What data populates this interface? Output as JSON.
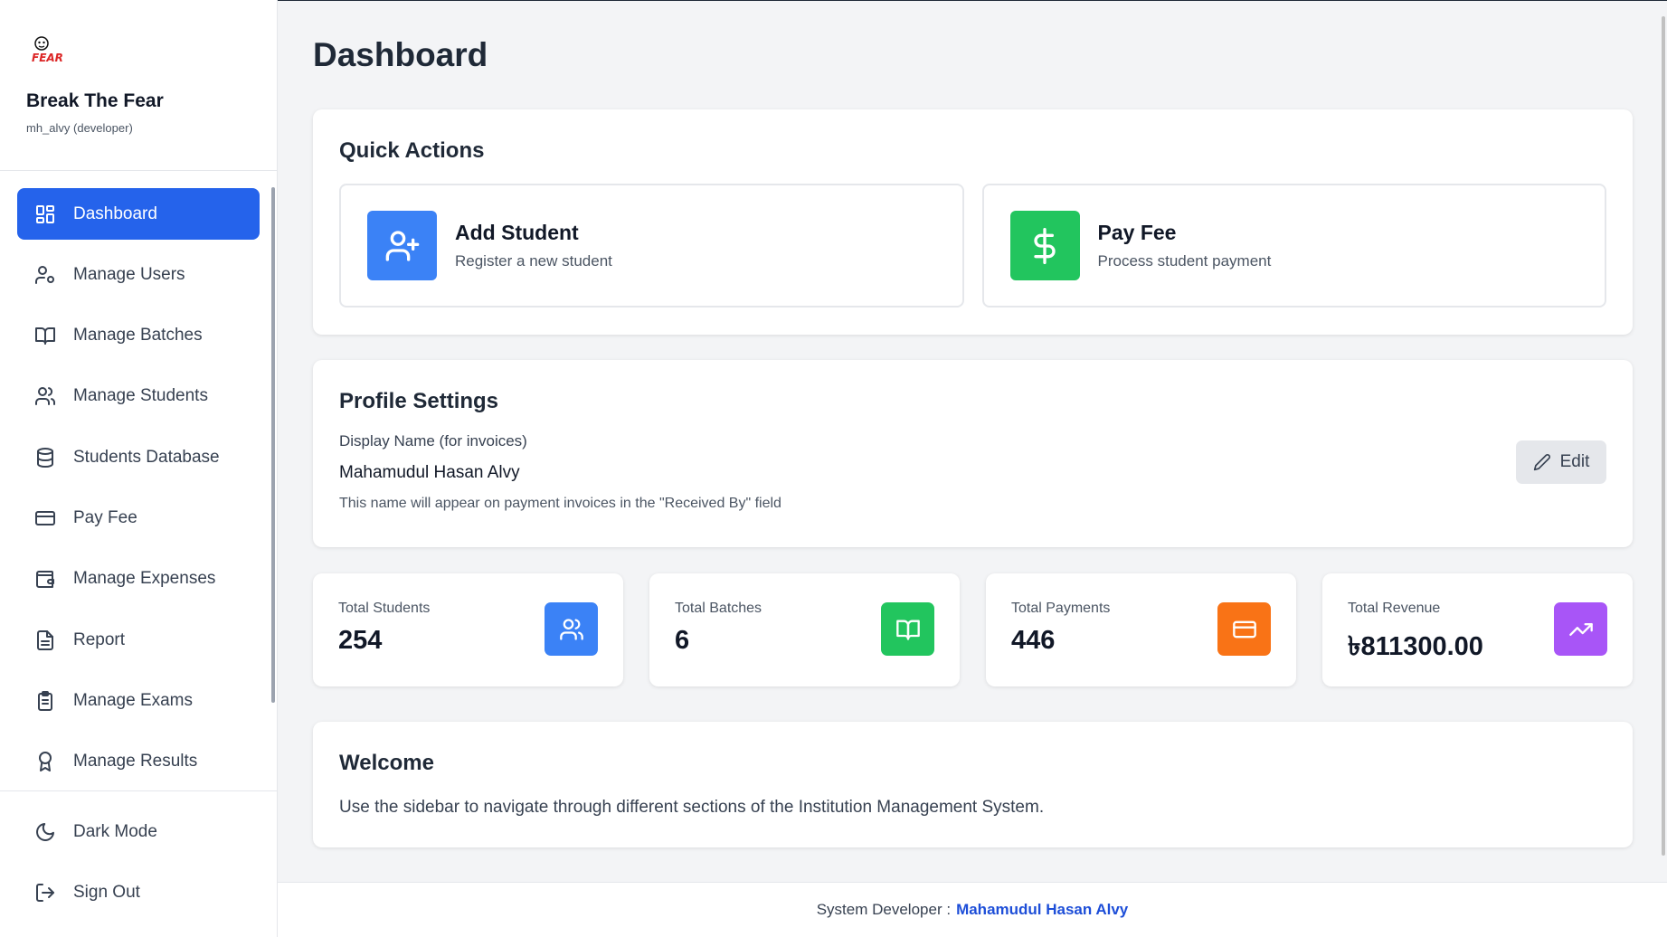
{
  "brand": {
    "name": "Break The Fear",
    "user": "mh_alvy (developer)",
    "logo_text": "FEAR"
  },
  "nav": {
    "items": [
      {
        "label": "Dashboard",
        "icon": "dashboard-icon",
        "active": true
      },
      {
        "label": "Manage Users",
        "icon": "user-cog-icon"
      },
      {
        "label": "Manage Batches",
        "icon": "book-open-icon"
      },
      {
        "label": "Manage Students",
        "icon": "users-icon"
      },
      {
        "label": "Students Database",
        "icon": "database-icon"
      },
      {
        "label": "Pay Fee",
        "icon": "credit-card-icon"
      },
      {
        "label": "Manage Expenses",
        "icon": "wallet-icon"
      },
      {
        "label": "Report",
        "icon": "file-text-icon"
      },
      {
        "label": "Manage Exams",
        "icon": "clipboard-icon"
      },
      {
        "label": "Manage Results",
        "icon": "award-icon"
      }
    ],
    "bottom": [
      {
        "label": "Dark Mode",
        "icon": "moon-icon"
      },
      {
        "label": "Sign Out",
        "icon": "sign-out-icon"
      }
    ]
  },
  "page": {
    "title": "Dashboard"
  },
  "quick_actions": {
    "title": "Quick Actions",
    "items": [
      {
        "label": "Add Student",
        "sub": "Register a new student",
        "icon": "user-plus-icon",
        "color": "#3b82f6"
      },
      {
        "label": "Pay Fee",
        "sub": "Process student payment",
        "icon": "dollar-icon",
        "color": "#22c55e"
      }
    ]
  },
  "profile": {
    "title": "Profile Settings",
    "field_label": "Display Name (for invoices)",
    "field_value": "Mahamudul Hasan Alvy",
    "help": "This name will appear on payment invoices in the \"Received By\" field",
    "edit_label": "Edit"
  },
  "stats": [
    {
      "label": "Total Students",
      "value": "254",
      "icon": "users-icon",
      "color": "#3b82f6"
    },
    {
      "label": "Total Batches",
      "value": "6",
      "icon": "book-open-icon",
      "color": "#22c55e"
    },
    {
      "label": "Total Payments",
      "value": "446",
      "icon": "credit-card-icon",
      "color": "#f97316"
    },
    {
      "label": "Total Revenue",
      "value": "৳811300.00",
      "icon": "trending-up-icon",
      "color": "#a855f7"
    }
  ],
  "welcome": {
    "title": "Welcome",
    "text": "Use the sidebar to navigate through different sections of the Institution Management System."
  },
  "footer": {
    "prefix": "System Developer :",
    "developer": "Mahamudul Hasan Alvy"
  },
  "colors": {
    "accent": "#2563eb"
  }
}
